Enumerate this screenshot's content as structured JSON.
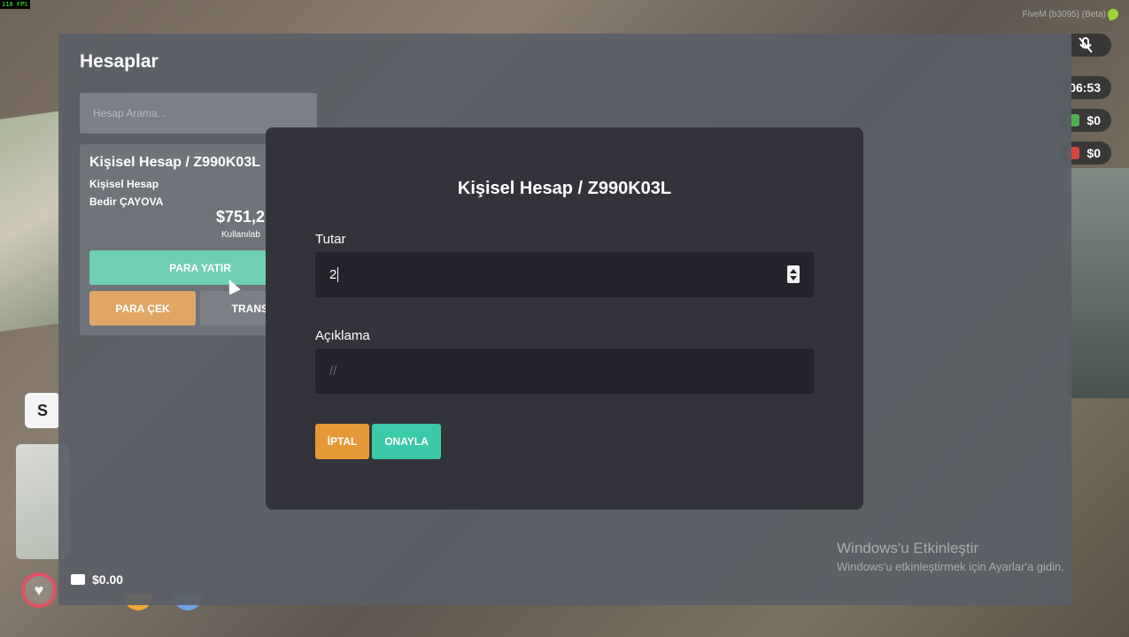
{
  "overlay": {
    "fps": "118 FPS",
    "fivem_label": "FiveM (b3095) (Beta)"
  },
  "hud": {
    "time": "06:53",
    "cash": "$0",
    "bank": "$0",
    "slot_key": "S",
    "wallet": "$0.00"
  },
  "app": {
    "title": "Hesaplar",
    "search_placeholder": "Hesap Arama..."
  },
  "account": {
    "title": "Kişisel Hesap / Z990K03L",
    "type": "Kişisel Hesap",
    "owner": "Bedir ÇAYOVA",
    "balance": "$751,2",
    "available": "Kullanılab",
    "deposit_label": "PARA YATIR",
    "withdraw_label": "PARA ÇEK",
    "transfer_label": "TRANSF"
  },
  "modal": {
    "title": "Kişisel Hesap / Z990K03L",
    "amount_label": "Tutar",
    "amount_value": "2",
    "description_label": "Açıklama",
    "description_placeholder": "//",
    "cancel_label": "İPTAL",
    "confirm_label": "ONAYLA"
  },
  "windows_activation": {
    "line1": "Windows'u Etkinleştir",
    "line2": "Windows'u etkinleştirmek için Ayarlar'a gidin."
  },
  "colors": {
    "deposit": "#6fcfb4",
    "withdraw": "#e1a666",
    "cancel": "#e59936",
    "confirm": "#3cc9a7",
    "modal_bg": "#33343b"
  }
}
